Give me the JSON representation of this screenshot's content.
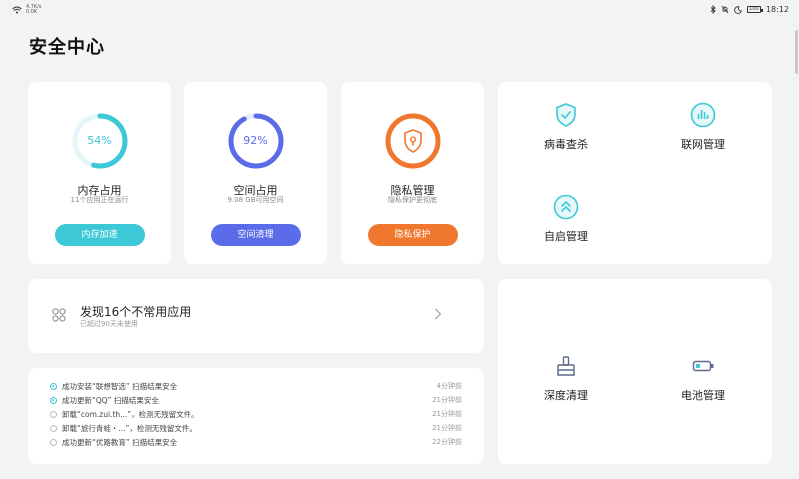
{
  "status_bar": {
    "network_label": "4.7K/s",
    "network_sub": "0.0K",
    "time": "18:12",
    "battery": "100",
    "icons": [
      "wifi-icon",
      "bluetooth-icon",
      "bell-off-icon",
      "moon-icon",
      "battery-icon"
    ]
  },
  "page": {
    "title": "安全中心"
  },
  "stats": [
    {
      "percent_label": "54%",
      "percent": 54,
      "title": "内存占用",
      "subtitle": "11个应用正在运行",
      "button": "内存加速",
      "color": "#3cc8d6"
    },
    {
      "percent_label": "92%",
      "percent": 92,
      "title": "空间占用",
      "subtitle": "9.08 GB可用空间",
      "button": "空间清理",
      "color": "#5b6ce8"
    },
    {
      "percent_label": "",
      "percent": 100,
      "title": "隐私管理",
      "subtitle": "隐私保护更彻底",
      "button": "隐私保护",
      "color": "#f0782e",
      "icon": "shield-lock-icon"
    }
  ],
  "tools_top": [
    {
      "label": "病毒查杀",
      "icon": "shield-check-icon"
    },
    {
      "label": "联网管理",
      "icon": "network-bars-icon"
    },
    {
      "label": "自启管理",
      "icon": "autostart-icon"
    }
  ],
  "discover": {
    "title": "发现16个不常用应用",
    "subtitle": "已超过90天未使用",
    "icon": "app-grid-icon",
    "arrow_icon": "chevron-right-icon"
  },
  "logs": [
    {
      "text": "成功安装“联想智选” 扫描结果安全",
      "time": "4分钟前",
      "status": "done"
    },
    {
      "text": "成功更新“QQ” 扫描结果安全",
      "time": "21分钟前",
      "status": "done"
    },
    {
      "text": "卸载“com.zui.th...”，检测无残留文件。",
      "time": "21分钟前",
      "status": "info"
    },
    {
      "text": "卸载“旅行青蛙・...”，检测无残留文件。",
      "time": "21分钟前",
      "status": "info"
    },
    {
      "text": "成功更新“优路教育” 扫描结果安全",
      "time": "22分钟前",
      "status": "info"
    }
  ],
  "tools_bottom": [
    {
      "label": "深度清理",
      "icon": "broom-icon"
    },
    {
      "label": "电池管理",
      "icon": "battery-outline-icon"
    }
  ],
  "colors": {
    "accent": "#3cc8d6",
    "background": "#f2f3f5",
    "card": "#ffffff"
  }
}
